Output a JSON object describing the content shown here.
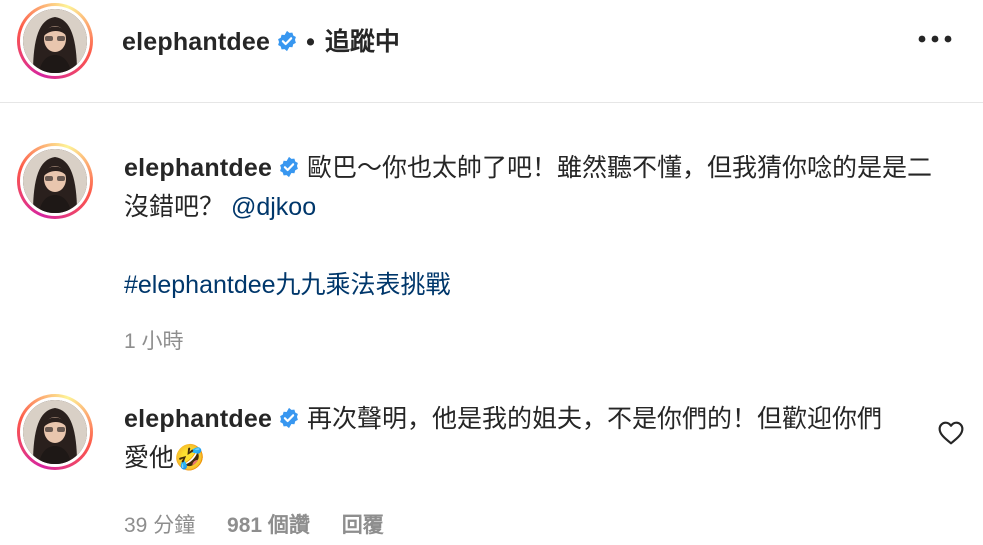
{
  "header": {
    "username": "elephantdee",
    "separator": "•",
    "follow_state": "追蹤中",
    "more_icon": "more-horizontal-icon"
  },
  "caption": {
    "username": "elephantdee",
    "text": "歐巴～你也太帥了吧！雖然聽不懂，但我猜你唸的是是二沒錯吧？",
    "mention": "@djkoo",
    "hashtag": "#elephantdee九九乘法表挑戰",
    "time": "1 小時"
  },
  "comment": {
    "username": "elephantdee",
    "text": "再次聲明，他是我的姐夫，不是你們的！但歡迎你們愛他",
    "emoji": "🤣",
    "time": "39 分鐘",
    "likes": "981 個讚",
    "reply": "回覆",
    "like_icon": "heart-outline-icon"
  },
  "colors": {
    "text": "#262626",
    "link": "#00376b",
    "muted": "#8e8e8e",
    "verified": "#3897f0",
    "divider": "#e6e6e6"
  }
}
